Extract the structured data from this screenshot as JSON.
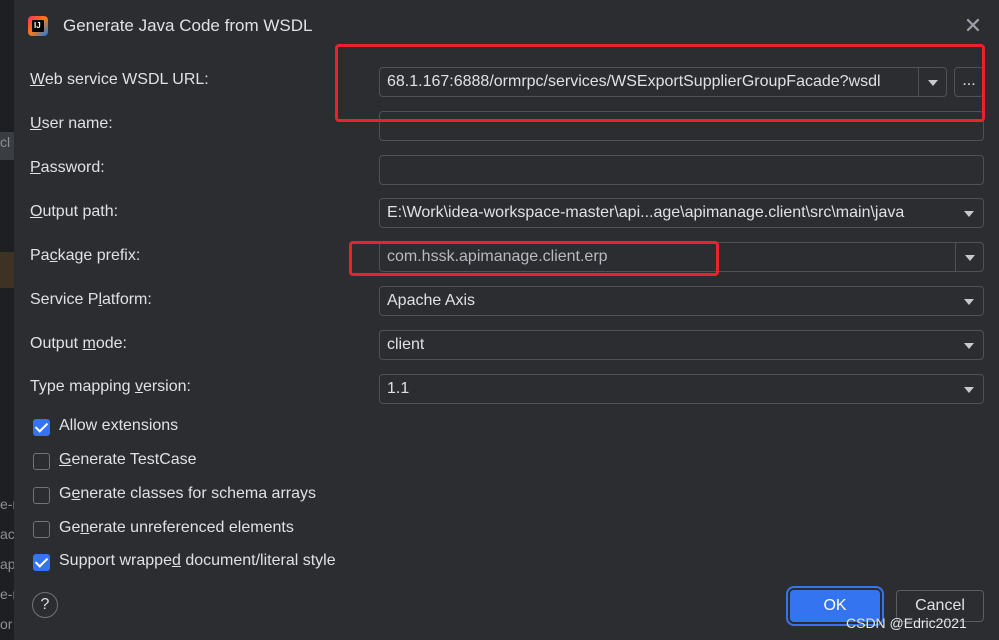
{
  "background_fragments": [
    "cl",
    "e-m",
    "ac",
    "ap",
    "e-r",
    "or"
  ],
  "dialog": {
    "title": "Generate Java Code from WSDL",
    "close_icon": "close-icon"
  },
  "form": {
    "wsdl_url": {
      "label_pre": "",
      "label_mnemonic": "W",
      "label_post": "eb service WSDL URL:",
      "value": "68.1.167:6888/ormrpc/services/WSExportSupplierGroupFacade?wsdl",
      "browse_label": "..."
    },
    "user_name": {
      "label_mnemonic": "U",
      "label_post": "ser name:",
      "value": ""
    },
    "password": {
      "label_mnemonic": "P",
      "label_post": "assword:",
      "value": ""
    },
    "output_path": {
      "label_mnemonic": "O",
      "label_post": "utput path:",
      "value": "E:\\Work\\idea-workspace-master\\api...age\\apimanage.client\\src\\main\\java"
    },
    "package_prefix": {
      "label_pre": "Pa",
      "label_mnemonic": "c",
      "label_post": "kage prefix:",
      "value": "com.hssk.apimanage.client.erp"
    },
    "service_platform": {
      "label_pre": "Service P",
      "label_mnemonic": "l",
      "label_post": "atform:",
      "value": "Apache Axis"
    },
    "output_mode": {
      "label_pre": "Output ",
      "label_mnemonic": "m",
      "label_post": "ode:",
      "value": "client"
    },
    "type_mapping": {
      "label_pre": "Type mapping ",
      "label_mnemonic": "v",
      "label_post": "ersion:",
      "value": "1.1"
    }
  },
  "options": [
    {
      "pre": "Allow extensions",
      "mn": "",
      "post": "",
      "checked": true
    },
    {
      "pre": "",
      "mn": "G",
      "post": "enerate TestCase",
      "checked": false
    },
    {
      "pre": "G",
      "mn": "e",
      "post": "nerate classes for schema arrays",
      "checked": false
    },
    {
      "pre": "Ge",
      "mn": "n",
      "post": "erate unreferenced elements",
      "checked": false
    },
    {
      "pre": "Support wrappe",
      "mn": "d",
      "post": " document/literal style",
      "checked": true
    }
  ],
  "footer": {
    "help_label": "?",
    "ok_label": "OK",
    "cancel_label": "Cancel"
  },
  "watermark": "CSDN @Edric2021",
  "colors": {
    "accent": "#3574f0",
    "highlight_box": "#e8232d",
    "background": "#2b2d30"
  }
}
